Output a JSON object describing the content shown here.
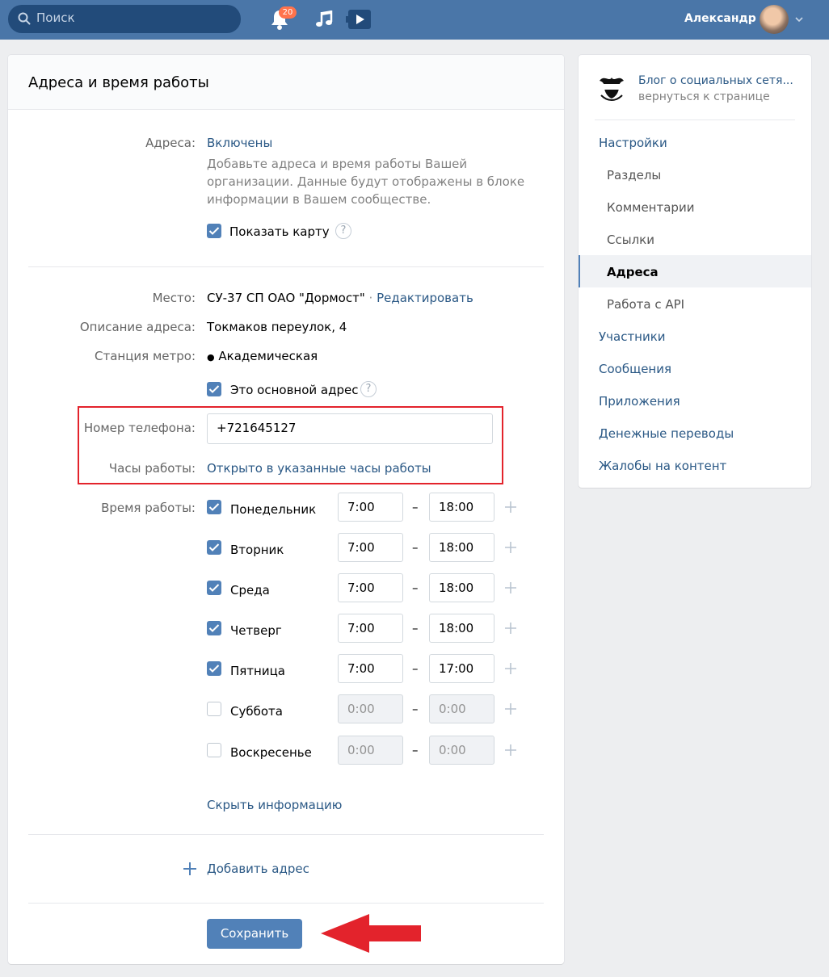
{
  "header": {
    "search_placeholder": "Поиск",
    "notifications_count": "20",
    "user_name": "Александр"
  },
  "page": {
    "title": "Адреса и время работы",
    "addresses_label": "Адреса:",
    "addresses_value": "Включены",
    "addresses_description": "Добавьте адреса и время работы Вашей организации. Данные будут отображены в блоке информации в Вашем сообществе.",
    "show_map_label": "Показать карту",
    "show_map_checked": true,
    "help_glyph": "?",
    "place_label": "Место:",
    "place_value": "СУ-37 СП ОАО \"Дормост\"",
    "separator": "·",
    "edit_link": "Редактировать",
    "address_desc_label": "Описание адреса:",
    "address_desc_value": "Токмаков переулок, 4",
    "metro_label": "Станция метро:",
    "metro_dot": "●",
    "metro_value": "Академическая",
    "main_address_label": "Это основной адрес",
    "main_address_checked": true,
    "phone_label": "Номер телефона:",
    "phone_value": "+721645127",
    "hours_label": "Часы работы:",
    "hours_value": "Открыто в указанные часы работы",
    "schedule_label": "Время работы:",
    "dash": "–",
    "schedule": [
      {
        "day": "Понедельник",
        "checked": true,
        "from": "7:00",
        "to": "18:00"
      },
      {
        "day": "Вторник",
        "checked": true,
        "from": "7:00",
        "to": "18:00"
      },
      {
        "day": "Среда",
        "checked": true,
        "from": "7:00",
        "to": "18:00"
      },
      {
        "day": "Четверг",
        "checked": true,
        "from": "7:00",
        "to": "18:00"
      },
      {
        "day": "Пятница",
        "checked": true,
        "from": "7:00",
        "to": "17:00"
      },
      {
        "day": "Суббота",
        "checked": false,
        "from": "0:00",
        "to": "0:00"
      },
      {
        "day": "Воскресенье",
        "checked": false,
        "from": "0:00",
        "to": "0:00"
      }
    ],
    "hide_info_link": "Скрыть информацию",
    "add_address_link": "Добавить адрес",
    "save_button": "Сохранить"
  },
  "sidebar": {
    "group_name": "Блог о социальных сетя...",
    "back_link": "вернуться к странице",
    "items": [
      {
        "label": "Настройки",
        "level": "top",
        "active": false
      },
      {
        "label": "Разделы",
        "level": "sub",
        "active": false
      },
      {
        "label": "Комментарии",
        "level": "sub",
        "active": false
      },
      {
        "label": "Ссылки",
        "level": "sub",
        "active": false
      },
      {
        "label": "Адреса",
        "level": "sub",
        "active": true
      },
      {
        "label": "Работа с API",
        "level": "sub",
        "active": false
      },
      {
        "label": "Участники",
        "level": "top",
        "active": false
      },
      {
        "label": "Сообщения",
        "level": "top",
        "active": false
      },
      {
        "label": "Приложения",
        "level": "top",
        "active": false
      },
      {
        "label": "Денежные переводы",
        "level": "top",
        "active": false
      },
      {
        "label": "Жалобы на контент",
        "level": "top",
        "active": false
      }
    ]
  },
  "colors": {
    "header_bg": "#4a76a8",
    "link": "#2a5885",
    "accent": "#5181b8",
    "highlight_red": "#e3232c"
  }
}
